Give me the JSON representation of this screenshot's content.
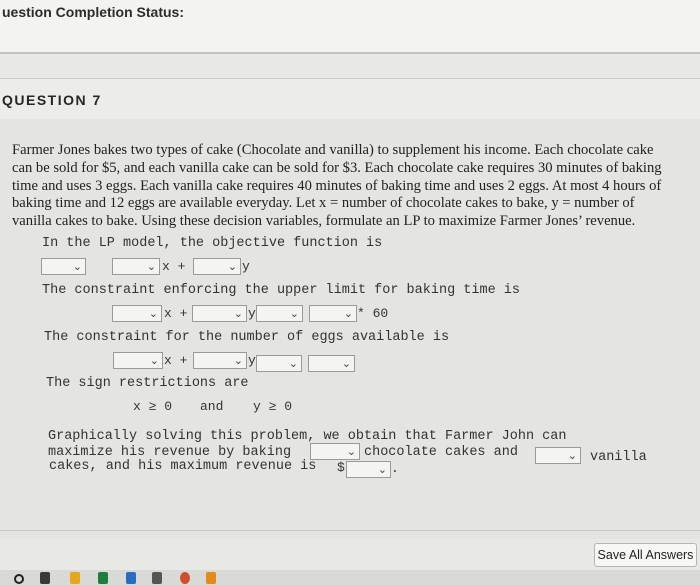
{
  "header": {
    "status_label": "uestion Completion Status:"
  },
  "question": {
    "title": "QUESTION 7"
  },
  "problem_lines": [
    "Farmer Jones bakes two types of cake (Chocolate and vanilla) to supplement his income.  Each chocolate cake",
    "can be sold for $5, and each vanilla cake can be sold for $3. Each chocolate cake requires 30 minutes of baking",
    "time and uses 3 eggs.  Each vanilla cake requires 40 minutes of baking time and uses 2 eggs. At most 4 hours of",
    "baking time and 12 eggs are available everyday. Let x = number of chocolate cakes to bake, y = number of",
    "vanilla cakes to bake. Using these decision variables, formulate an LP to maximize Farmer Jones’ revenue."
  ],
  "objective": {
    "text": "In the LP model, the objective function is",
    "x_term": "x +",
    "y_term": "y"
  },
  "baking": {
    "text": "The constraint enforcing the upper limit for baking time is",
    "x_term": "x +",
    "y_term": "y",
    "multiplier": "* 60"
  },
  "eggs": {
    "text": "The constraint for the number of eggs available is",
    "x_term": "x +",
    "y_term": "y"
  },
  "sign": {
    "text": "The sign restrictions are",
    "x_ge": "x ≥ 0",
    "and": "and",
    "y_ge": "y ≥ 0"
  },
  "graphical": {
    "line1": "Graphically solving this problem, we obtain that Farmer John can",
    "line2a": "maximize his revenue by baking",
    "line2b": "chocolate cakes and",
    "line2c": "vanilla",
    "line3a": "cakes, and his maximum revenue is",
    "dollar": "$",
    "period": "."
  },
  "footer": {
    "save_all_label": "Save All Answers"
  },
  "icons": {
    "chevron": "chevron-down-icon"
  }
}
